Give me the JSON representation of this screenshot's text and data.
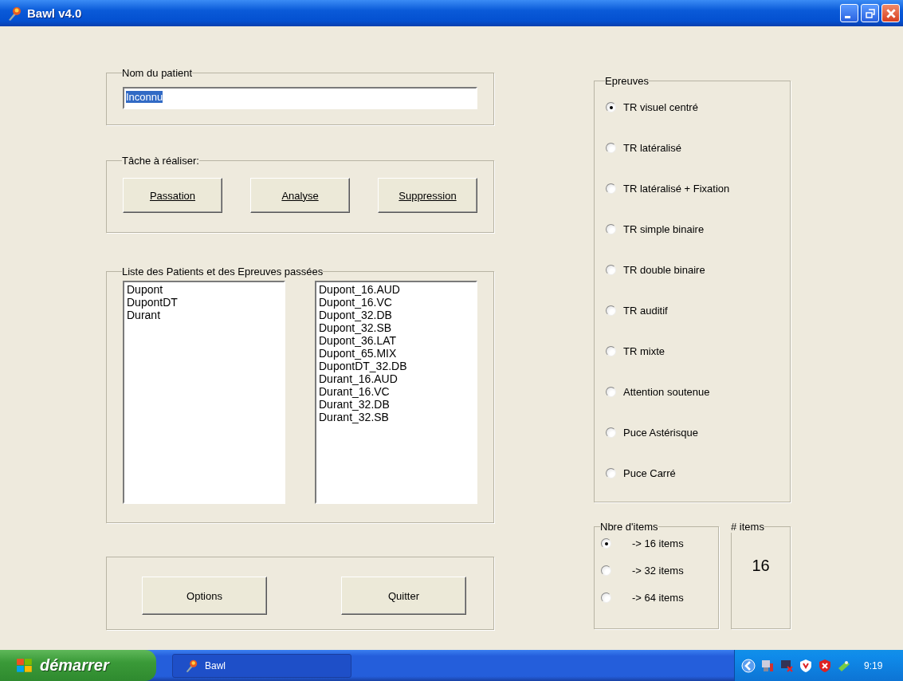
{
  "window": {
    "title": "Bawl v4.0"
  },
  "patient": {
    "legend": "Nom du patient",
    "value": "Inconnu",
    "text_selected": true
  },
  "task": {
    "legend": "Tâche à réaliser:",
    "buttons": [
      "Passation",
      "Analyse",
      "Suppression"
    ]
  },
  "lists": {
    "legend": "Liste des Patients et des Epreuves passées",
    "patients": [
      "Dupont",
      "DupontDT",
      "Durant"
    ],
    "tests": [
      "Dupont_16.AUD",
      "Dupont_16.VC",
      "Dupont_32.DB",
      "Dupont_32.SB",
      "Dupont_36.LAT",
      "Dupont_65.MIX",
      "DupontDT_32.DB",
      "Durant_16.AUD",
      "Durant_16.VC",
      "Durant_32.DB",
      "Durant_32.SB"
    ]
  },
  "bottom_buttons": [
    "Options",
    "Quitter"
  ],
  "epreuves": {
    "legend": "Epreuves",
    "options": [
      {
        "label": "TR visuel centré",
        "selected": true
      },
      {
        "label": "TR latéralisé",
        "selected": false
      },
      {
        "label": "TR latéralisé + Fixation",
        "selected": false
      },
      {
        "label": "TR simple binaire",
        "selected": false
      },
      {
        "label": "TR double binaire",
        "selected": false
      },
      {
        "label": "TR auditif",
        "selected": false
      },
      {
        "label": "TR mixte",
        "selected": false
      },
      {
        "label": "Attention soutenue",
        "selected": false
      },
      {
        "label": "Puce  Astérisque",
        "selected": false
      },
      {
        "label": "Puce  Carré",
        "selected": false
      }
    ]
  },
  "item_count": {
    "legend": "Nbre d'items",
    "options": [
      {
        "label": "->  16 items",
        "selected": true
      },
      {
        "label": "->  32 items",
        "selected": false
      },
      {
        "label": "->  64 items",
        "selected": false
      }
    ]
  },
  "items_display": {
    "legend": "# items",
    "value": "16"
  },
  "taskbar": {
    "start": "démarrer",
    "app": "Bawl",
    "clock": "9:19"
  }
}
